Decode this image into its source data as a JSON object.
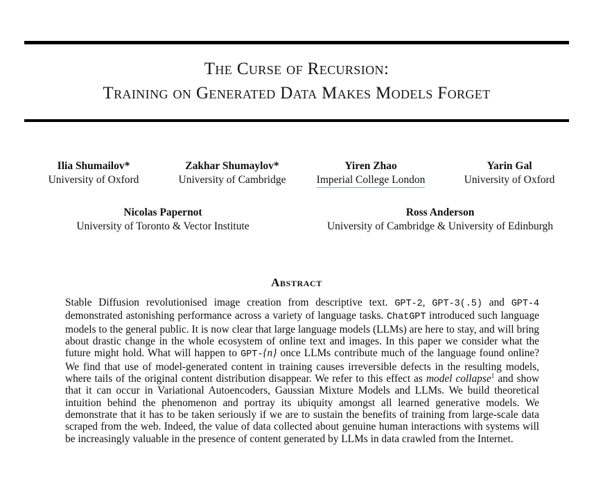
{
  "paper": {
    "title": {
      "line1": "The Curse of Recursion:",
      "line2": "Training on Generated Data Makes Models Forget"
    },
    "authors": {
      "row1": [
        {
          "name": "Ilia Shumailov*",
          "affiliation": "University of Oxford",
          "is_link": false
        },
        {
          "name": "Zakhar Shumaylov*",
          "affiliation": "University of Cambridge",
          "is_link": false
        },
        {
          "name": "Yiren Zhao",
          "affiliation": "Imperial College London",
          "is_link": true
        },
        {
          "name": "Yarin Gal",
          "affiliation": "University of Oxford",
          "is_link": false
        }
      ],
      "row2": [
        {
          "name": "Nicolas Papernot",
          "affiliation": "University of Toronto & Vector Institute",
          "is_link": false
        },
        {
          "name": "Ross Anderson",
          "affiliation": "University of Cambridge & University of Edinburgh",
          "is_link": false
        }
      ]
    },
    "abstract": {
      "heading": "Abstract",
      "segments": {
        "s1": "Stable Diffusion revolutionised image creation from descriptive text. ",
        "m1": "GPT-2",
        "s2": ", ",
        "m2": "GPT-3(.5)",
        "s3": " and ",
        "m3": "GPT-4",
        "s4": " demonstrated astonishing performance across a variety of language tasks. ",
        "m4": "ChatGPT",
        "s5": " introduced such language models to the general public. It is now clear that large language models (LLMs) are here to stay, and will bring about drastic change in the whole ecosystem of online text and images. In this paper we consider what the future might hold. What will happen to ",
        "m5": "GPT-",
        "m5b": "{",
        "m5n": "n",
        "m5c": "}",
        "s6": " once LLMs contribute much of the language found online? We find that use of model-generated content in training causes irreversible defects in the resulting models, where tails of the original content distribution disappear. We refer to this effect as ",
        "i1": "model collapse",
        "fn1": "1",
        "s7": " and show that it can occur in Variational Autoencoders, Gaussian Mixture Models and LLMs. We build theoretical intuition behind the phenomenon and portray its ubiquity amongst all learned generative models. We demonstrate that it has to be taken seriously if we are to sustain the benefits of training from large-scale data scraped from the web. Indeed, the value of data collected about genuine human interactions with systems will be increasingly valuable in the presence of content generated by LLMs in data crawled from the Internet."
      }
    },
    "colors": {
      "rule": "#000000",
      "text": "#000000",
      "link_underline": "#8aa6bd"
    }
  }
}
